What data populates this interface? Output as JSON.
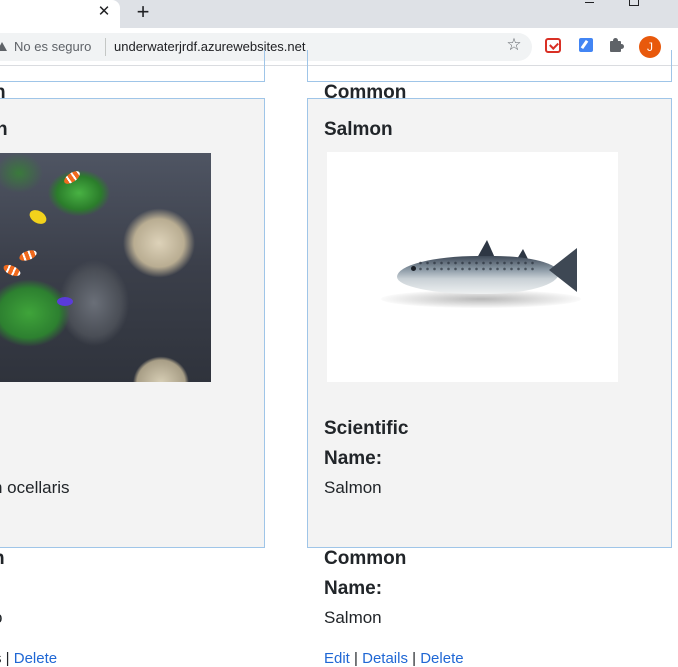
{
  "browser": {
    "tab_close": "✕",
    "new_tab": "+",
    "security_label": "No es seguro",
    "url": "underwaterjrdf.azurewebsites.net",
    "star": "☆",
    "avatar_initial": "J"
  },
  "left_card": {
    "top_partial_label": "n",
    "title_partial": "h",
    "label_partial": ":",
    "scientific_partial": "n ocellaris",
    "below_label_partial": "n",
    "below_value_partial": "o",
    "links_partial": "s |",
    "delete_link": "Delete"
  },
  "right_card": {
    "top_partial_label": "Common",
    "title": "Salmon",
    "scientific_label_line1": "Scientific",
    "scientific_label_line2": "Name:",
    "scientific_value": "Salmon",
    "common_label_line1": "Common",
    "common_label_line2": "Name:",
    "common_value": "Salmon",
    "edit_link": "Edit",
    "details_link": "Details",
    "delete_link": "Delete",
    "separator": "|"
  }
}
